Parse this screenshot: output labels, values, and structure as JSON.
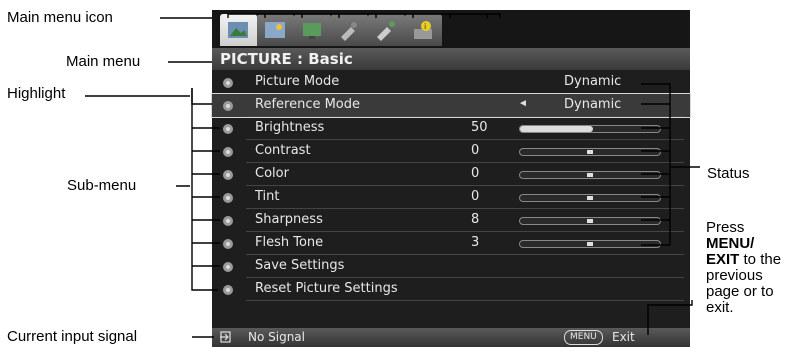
{
  "callouts": {
    "main_menu_icon": "Main menu icon",
    "main_menu": "Main menu",
    "highlight": "Highlight",
    "sub_menu": "Sub-menu",
    "status": "Status",
    "press_line1": "Press",
    "press_line2": "MENU/",
    "press_line3": "EXIT",
    "press_line3_rest": " to the",
    "press_line4": "previous",
    "press_line5": "page or to",
    "press_line6": "exit.",
    "current_input": "Current input signal"
  },
  "osd": {
    "tabs": [
      "picture-icon",
      "picture-advanced-icon",
      "display-icon",
      "setup-basic-icon",
      "setup-advanced-icon",
      "information-icon"
    ],
    "menu_title": "PICTURE : Basic",
    "rows": [
      {
        "label": "Picture Mode",
        "status": "Dynamic",
        "icon": "picture-mode-icon"
      },
      {
        "label": "Reference Mode",
        "status": "Dynamic",
        "icon": "reference-mode-icon",
        "highlighted": true
      },
      {
        "label": "Brightness",
        "value": "50",
        "level": 0.52,
        "icon": "brightness-icon"
      },
      {
        "label": "Contrast",
        "value": "0",
        "level": 0.5,
        "icon": "contrast-icon"
      },
      {
        "label": "Color",
        "value": "0",
        "level": 0.5,
        "icon": "color-icon"
      },
      {
        "label": "Tint",
        "value": "0",
        "level": 0.5,
        "icon": "tint-icon"
      },
      {
        "label": "Sharpness",
        "value": "8",
        "level": 0.5,
        "icon": "sharpness-icon"
      },
      {
        "label": "Flesh Tone",
        "value": "3",
        "level": 0.5,
        "icon": "flesh-tone-icon"
      },
      {
        "label": "Save Settings",
        "icon": "save-settings-icon"
      },
      {
        "label": "Reset Picture Settings",
        "icon": "reset-icon"
      }
    ],
    "status_bar": {
      "signal": "No Signal",
      "menu_key": "MENU",
      "exit": "Exit"
    }
  }
}
